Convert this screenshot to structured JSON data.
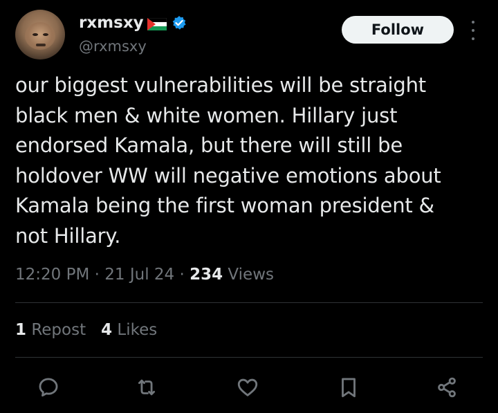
{
  "author": {
    "display_name": "rxmsxy",
    "handle": "@rxmsxy",
    "flag_icon": "palestine-flag-icon",
    "verified_icon": "verified-badge-icon",
    "verified_color": "#1d9bf0"
  },
  "header": {
    "follow_label": "Follow",
    "more_icon": "more-vertical-icon"
  },
  "tweet": {
    "lines": [
      "our biggest vulnerabilities will be straight",
      "black men & white women. Hillary just",
      "endorsed Kamala, but there will still be",
      "holdover WW will negative emotions about",
      "Kamala being the first woman president &",
      "not Hillary."
    ]
  },
  "meta": {
    "time": "12:20 PM",
    "sep1": " · ",
    "date": "21 Jul 24",
    "sep2": " · ",
    "views_count": "234",
    "views_label": " Views"
  },
  "stats": {
    "reposts_count": "1",
    "reposts_label": " Repost",
    "likes_count": "4",
    "likes_label": " Likes"
  },
  "actions": {
    "reply_icon": "reply-icon",
    "repost_icon": "repost-icon",
    "like_icon": "heart-icon",
    "bookmark_icon": "bookmark-icon",
    "share_icon": "share-icon"
  },
  "colors": {
    "background": "#000000",
    "text_primary": "#e7e9ea",
    "text_secondary": "#71767b",
    "divider": "#2f3336",
    "follow_bg": "#eff3f4",
    "follow_text": "#0f1419"
  }
}
